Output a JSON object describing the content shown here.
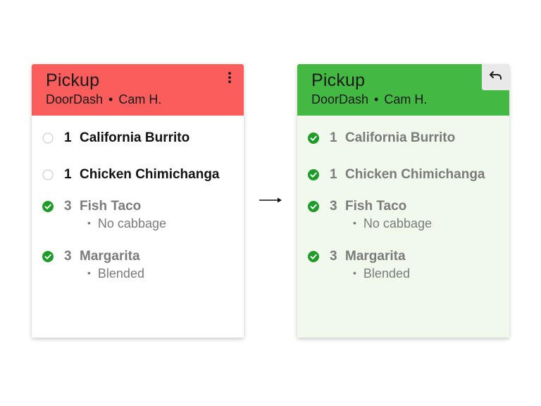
{
  "colors": {
    "header_pending": "#fb5c5c",
    "header_complete": "#43b944",
    "check_green": "#1f9b2a",
    "card_complete_bg": "#f1f9ec"
  },
  "tickets": [
    {
      "state": "pending",
      "order_type": "Pickup",
      "service": "DoorDash",
      "separator": "•",
      "customer": "Cam H.",
      "header_action_icon": "more-vertical-icon",
      "items": [
        {
          "checked": false,
          "qty": "1",
          "name": "California Burrito",
          "modifier": ""
        },
        {
          "checked": false,
          "qty": "1",
          "name": "Chicken Chimichanga",
          "modifier": ""
        },
        {
          "checked": true,
          "qty": "3",
          "name": "Fish Taco",
          "modifier": "No cabbage"
        },
        {
          "checked": true,
          "qty": "3",
          "name": "Margarita",
          "modifier": "Blended"
        }
      ]
    },
    {
      "state": "complete",
      "order_type": "Pickup",
      "service": "DoorDash",
      "separator": "•",
      "customer": "Cam H.",
      "header_action_icon": "undo-icon",
      "items": [
        {
          "checked": true,
          "qty": "1",
          "name": "California Burrito",
          "modifier": ""
        },
        {
          "checked": true,
          "qty": "1",
          "name": "Chicken Chimichanga",
          "modifier": ""
        },
        {
          "checked": true,
          "qty": "3",
          "name": "Fish Taco",
          "modifier": "No cabbage"
        },
        {
          "checked": true,
          "qty": "3",
          "name": "Margarita",
          "modifier": "Blended"
        }
      ]
    }
  ],
  "transition_icon": "arrow-right-icon",
  "bullet": "•"
}
